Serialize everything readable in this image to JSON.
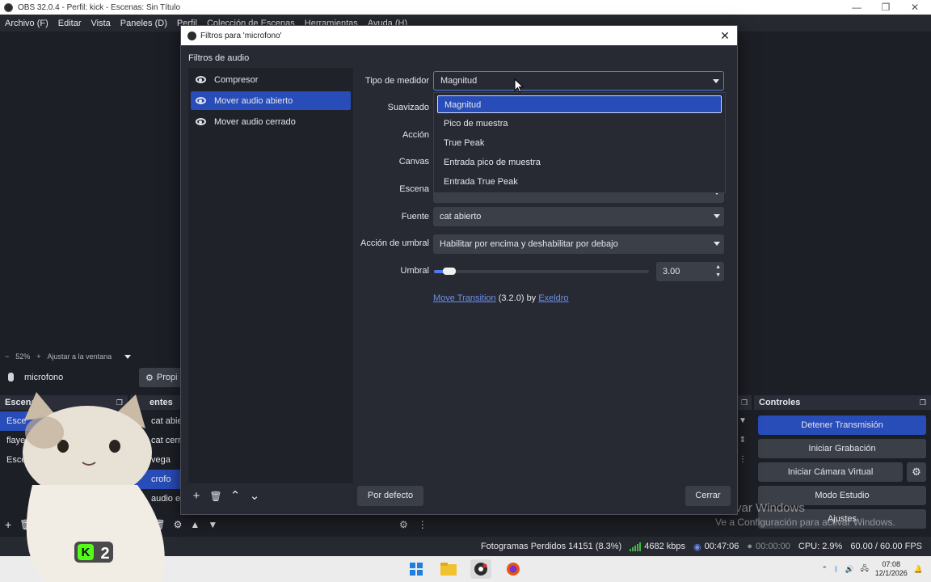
{
  "window": {
    "title": "OBS 32.0.4 - Perfil: kick - Escenas: Sin Título"
  },
  "menubar": {
    "items": [
      "Archivo (F)",
      "Editar",
      "Vista",
      "Paneles (D)",
      "Perfil",
      "Colección de Escenas",
      "Herramientas",
      "Ayuda (H)"
    ]
  },
  "preview_bar": {
    "minus": "−",
    "zoom": "52%",
    "plus": "+",
    "fit": "Ajustar a la ventana"
  },
  "source_row": {
    "name": "microfono",
    "props_label": "Propi"
  },
  "panels": {
    "scenes": "Escenas",
    "sources": "entes",
    "controls": "Controles"
  },
  "scenes": [
    "Esce",
    "flayer",
    "Escena"
  ],
  "sources": [
    "cat abie",
    "cat cerra",
    "vega",
    "crofo",
    "audio es"
  ],
  "controls": {
    "stop_stream": "Detener Transmisión",
    "start_record": "Iniciar Grabación",
    "virtual_cam": "Iniciar Cámara Virtual",
    "studio_mode": "Modo Estudio",
    "settings": "Ajustes"
  },
  "watermark": {
    "line1": "Activar Windows",
    "line2": "Ve a Configuración para activar Windows."
  },
  "statusbar": {
    "dropped": "Fotogramas Perdidos 14151 (8.3%)",
    "bitrate": "4682 kbps",
    "stream_time": "00:47:06",
    "record_time": "00:00:00",
    "cpu": "CPU: 2.9%",
    "fps": "60.00 / 60.00 FPS"
  },
  "taskbar": {
    "time": "07:08",
    "date": "12/1/2026"
  },
  "overlay": {
    "badge_letter": "K",
    "badge_number": "2"
  },
  "dialog": {
    "title": "Filtros para 'microfono'",
    "close": "✕",
    "filters_label": "Filtros de audio",
    "filters": [
      {
        "label": "Compresor",
        "selected": false
      },
      {
        "label": "Mover audio abierto",
        "selected": true
      },
      {
        "label": "Mover audio cerrado",
        "selected": false
      }
    ],
    "tools": {
      "add": "+",
      "remove": "🗑",
      "up": "⌃",
      "down": "⌄"
    },
    "defaults_btn": "Por defecto",
    "close_btn": "Cerrar",
    "props": {
      "meter_type_label": "Tipo de medidor",
      "meter_type_value": "Magnitud",
      "smoothing_label": "Suavizado",
      "action_label": "Acción",
      "canvas_label": "Canvas",
      "scene_label": "Escena",
      "source_label": "Fuente",
      "source_value": "cat abierto",
      "threshold_action_label": "Acción de umbral",
      "threshold_action_value": "Habilitar por encima y deshabilitar por debajo",
      "threshold_label": "Umbral",
      "threshold_value": "3.00",
      "threshold_fraction": 0.05
    },
    "dropdown": {
      "options": [
        "Magnitud",
        "Pico de muestra",
        "True Peak",
        "Entrada pico de muestra",
        "Entrada True Peak"
      ],
      "selected": "Magnitud"
    },
    "plugin": {
      "name": "Move Transition",
      "version": "(3.2.0) by",
      "author": "Exeldro"
    }
  },
  "colors": {
    "accent": "#284cb8",
    "panel": "#272a33",
    "background": "#1d1f26",
    "button": "#3b3f48",
    "link": "#6d8fe8",
    "signal_green": "#3fbb42"
  }
}
